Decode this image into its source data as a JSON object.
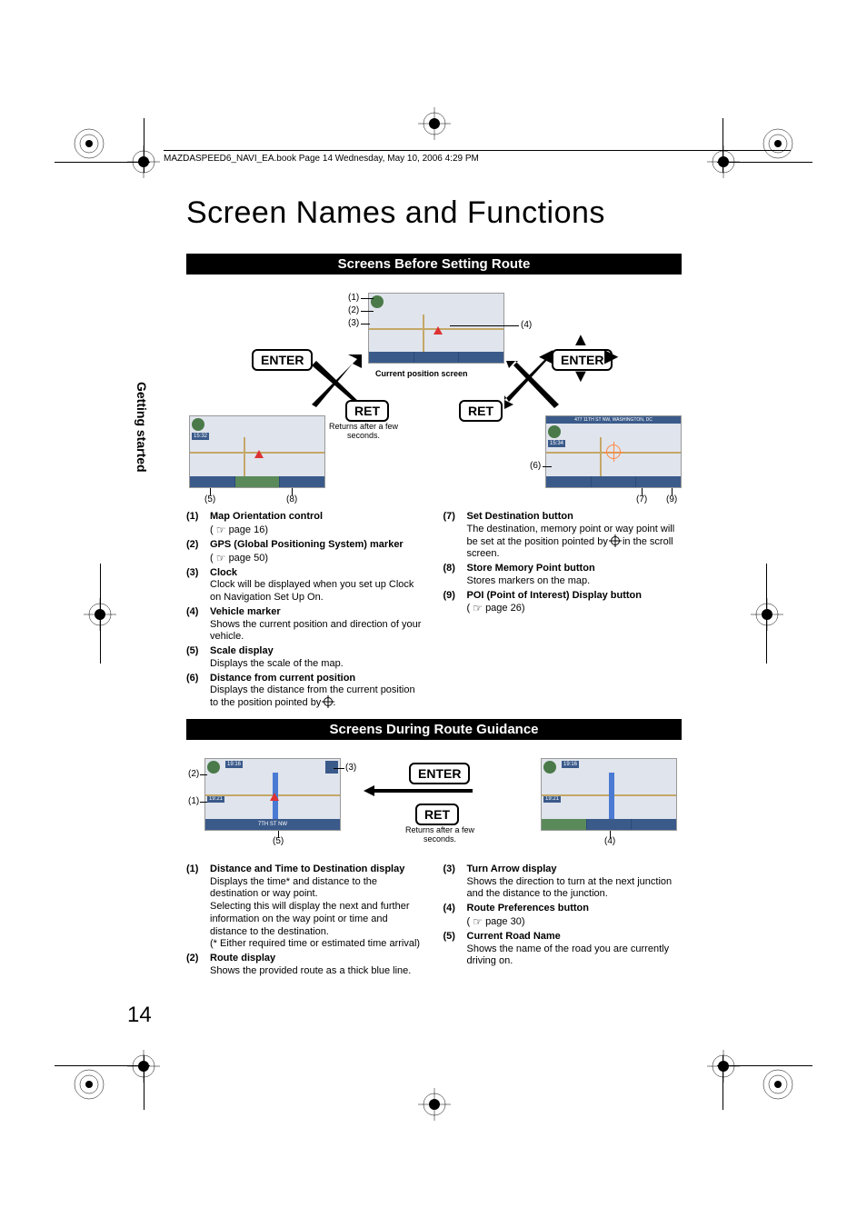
{
  "header_footer_text": "MAZDASPEED6_NAVI_EA.book  Page 14  Wednesday, May 10, 2006  4:29 PM",
  "page_number": "14",
  "sidebar_tab": "Getting started",
  "title": "Screen Names and Functions",
  "section1": {
    "heading": "Screens Before Setting Route",
    "enter_label": "ENTER",
    "ret_label": "RET",
    "returns_text": "Returns after a few seconds.",
    "current_pos_label": "Current position screen",
    "screen_right_header": "477 11TH ST NW, WASHINGTON, DC",
    "callouts": {
      "c1": "(1)",
      "c2": "(2)",
      "c3": "(3)",
      "c4": "(4)",
      "c5": "(5)",
      "c6": "(6)",
      "c7": "(7)",
      "c8": "(8)",
      "c9": "(9)"
    },
    "defs_left": [
      {
        "num": "(1)",
        "title": "Map Orientation control",
        "body": "",
        "ref": "page 16"
      },
      {
        "num": "(2)",
        "title": "GPS (Global Positioning System) marker",
        "body": "",
        "ref": "page 50"
      },
      {
        "num": "(3)",
        "title": "Clock",
        "body": "Clock will be displayed when you set up Clock on Navigation Set Up On."
      },
      {
        "num": "(4)",
        "title": "Vehicle marker",
        "body": "Shows the current position and direction of your vehicle."
      },
      {
        "num": "(5)",
        "title": "Scale display",
        "body": "Displays the scale of the map."
      },
      {
        "num": "(6)",
        "title": "Distance from current position",
        "body": "Displays the distance from the current position to the position pointed by ",
        "suffix": "."
      }
    ],
    "defs_right": [
      {
        "num": "(7)",
        "title": "Set Destination button",
        "body": "The destination, memory point or way point will be set at the position pointed by ",
        "suffix": " in the scroll screen."
      },
      {
        "num": "(8)",
        "title": "Store Memory Point button",
        "body": "Stores markers on the map."
      },
      {
        "num": "(9)",
        "title": "POI (Point of Interest) Display button",
        "body": "",
        "ref": "page 26"
      }
    ]
  },
  "section2": {
    "heading": "Screens During Route Guidance",
    "enter_label": "ENTER",
    "ret_label": "RET",
    "returns_text": "Returns after a few seconds.",
    "road_name": "7TH ST NW",
    "callouts": {
      "c1": "(1)",
      "c2": "(2)",
      "c3": "(3)",
      "c4": "(4)",
      "c5": "(5)"
    },
    "defs_left": [
      {
        "num": "(1)",
        "title": "Distance and Time to Destination display",
        "body": "Displays the time* and distance to the destination or way point.\nSelecting this will display the next and further information on the way point or time and distance to the destination.\n(* Either required time or estimated time arrival)"
      },
      {
        "num": "(2)",
        "title": "Route display",
        "body": "Shows the provided route as a thick blue line."
      }
    ],
    "defs_right": [
      {
        "num": "(3)",
        "title": "Turn Arrow display",
        "body": "Shows the direction to turn at the next junction and the distance to the junction."
      },
      {
        "num": "(4)",
        "title": "Route Preferences button",
        "body": "",
        "ref": "page 30"
      },
      {
        "num": "(5)",
        "title": "Current Road Name",
        "body": "Shows the name of the road you are currently driving on."
      }
    ]
  }
}
